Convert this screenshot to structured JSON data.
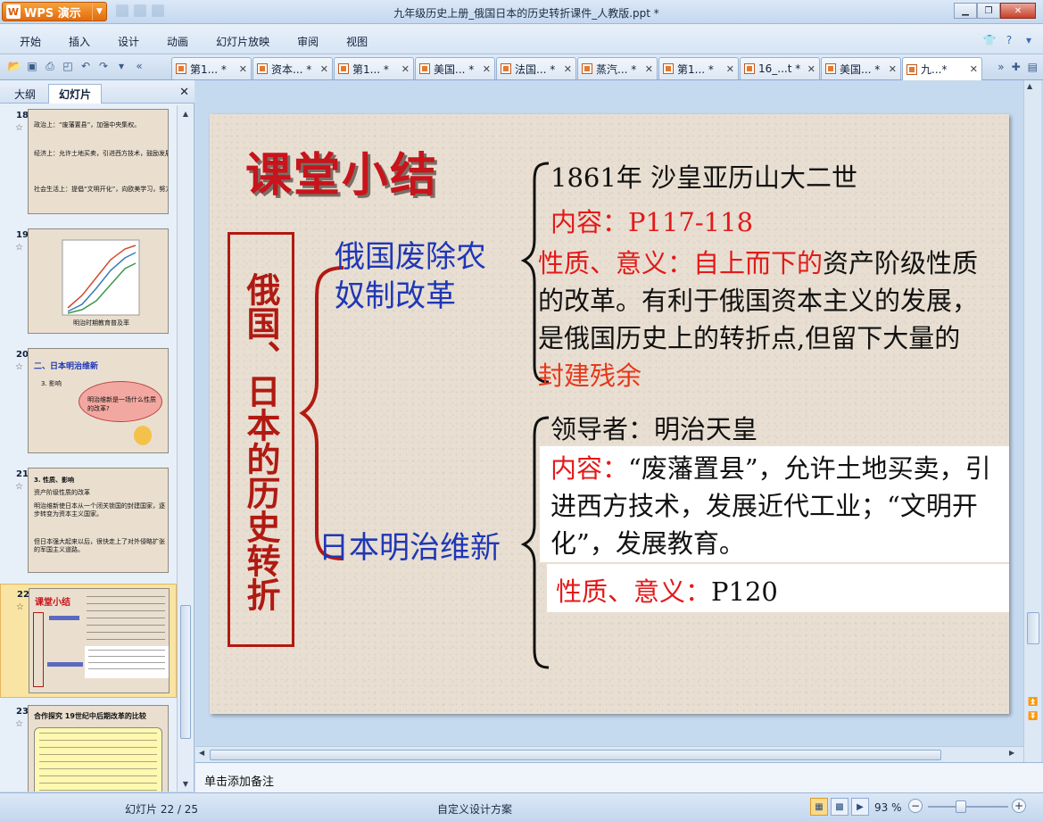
{
  "app": {
    "brand": "WPS 演示",
    "window_title": "九年级历史上册_俄国日本的历史转折课件_人教版.ppt *"
  },
  "menu": [
    "开始",
    "插入",
    "设计",
    "动画",
    "幻灯片放映",
    "审阅",
    "视图"
  ],
  "tabs": [
    {
      "label": "第1... *",
      "active": false
    },
    {
      "label": "资本... *",
      "active": false
    },
    {
      "label": "第1... *",
      "active": false
    },
    {
      "label": "美国... *",
      "active": false
    },
    {
      "label": "法国... *",
      "active": false
    },
    {
      "label": "蒸汽... *",
      "active": false
    },
    {
      "label": "第1... *",
      "active": false
    },
    {
      "label": "16_...t *",
      "active": false
    },
    {
      "label": "美国... *",
      "active": false
    },
    {
      "label": "九...*",
      "active": true
    }
  ],
  "left_panel": {
    "tab_outline": "大纲",
    "tab_slides": "幻灯片",
    "thumbnails": [
      {
        "num": "18",
        "lines": [
          "政治上：“废藩置县”，加强中央集权。",
          "经济上：允许土地买卖，引进西方技术，鼓励发展近代企业。",
          "社会生活上：提倡“文明开化”，向欧美学习，努力发展教育。"
        ]
      },
      {
        "num": "19",
        "lines": [
          "明治时期教育普及率"
        ]
      },
      {
        "num": "20",
        "lines": [
          "二、日本明治维新",
          "3. 影响",
          "明治维新是一场什么性质的改革?"
        ]
      },
      {
        "num": "21",
        "lines": [
          "3. 性质、影响",
          "资产阶级性质的改革",
          "明治维新使日本从一个闭关锁国的封建国家，逐步转变为资本主义国家。",
          "但日本强大起来以后，很快走上了对外侵略扩张的军国主义道路。"
        ]
      },
      {
        "num": "22",
        "lines": [
          "课堂小结"
        ]
      },
      {
        "num": "23",
        "lines": [
          "合作探究  19世纪中后期改革的比较"
        ]
      }
    ]
  },
  "slide": {
    "heading": "课堂小结",
    "vertical_title": "俄国、日本的历史转折",
    "russia": {
      "label": "俄国废除农奴制改革",
      "year_line": "1861年  沙皇亚历山大二世",
      "content_line": "内容：P117-118",
      "nature_prefix": "性质、意义：自上而下的",
      "nature_body": "资产阶级性质的改革。有利于俄国资本主义的发展，是俄国历史上的转折点,但留下大量的",
      "nature_suffix": "封建残余"
    },
    "japan": {
      "label": "日本明治维新",
      "leader_line": "领导者：明治天皇",
      "content_prefix": "内容：",
      "content_body": "“废藩置县”，允许土地买卖，引进西方技术，发展近代工业；“文明开化”，发展教育。",
      "nature_prefix": "性质、意义：",
      "nature_body": "P120"
    }
  },
  "notes": {
    "placeholder": "单击添加备注"
  },
  "status": {
    "slide_count": "幻灯片 22 / 25",
    "design": "自定义设计方案",
    "zoom": "93 %"
  }
}
